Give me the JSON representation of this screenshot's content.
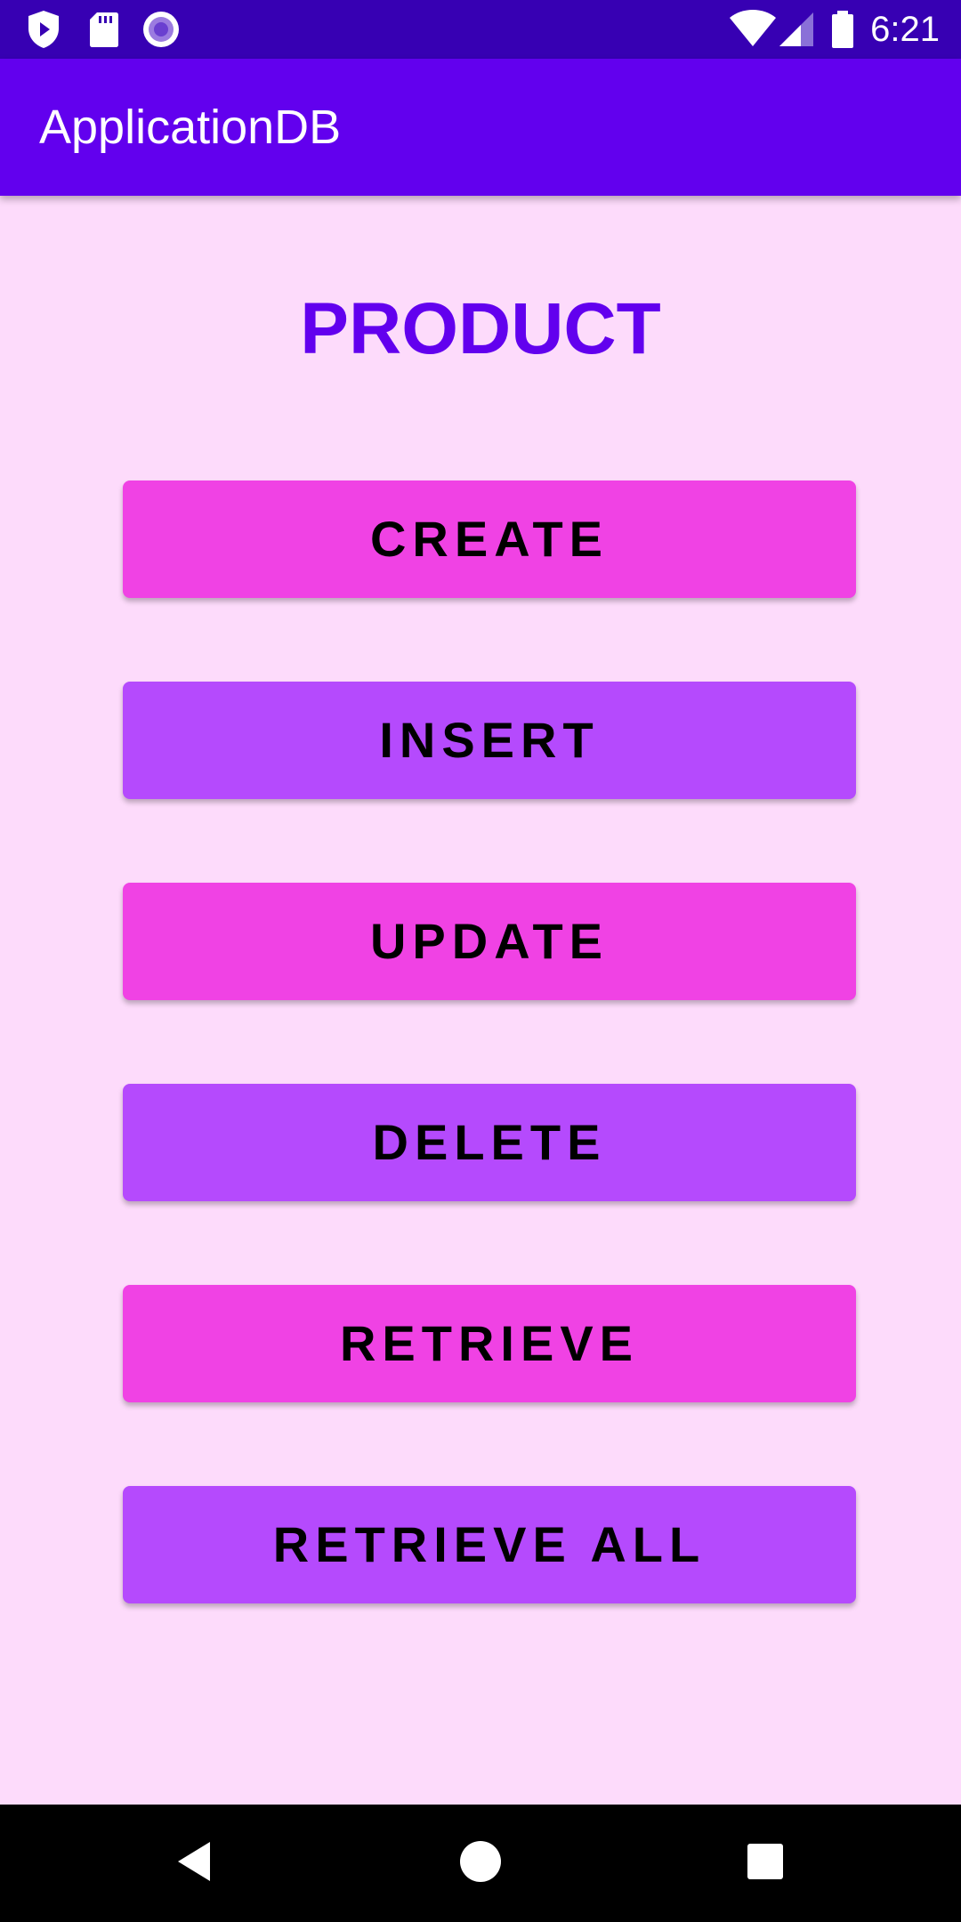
{
  "status_bar": {
    "time": "6:21",
    "left_icons": [
      "shield-play-icon",
      "sd-card-icon",
      "record-icon"
    ],
    "right_icons": [
      "wifi-icon",
      "cell-signal-icon",
      "battery-icon"
    ],
    "background": "#3700B3"
  },
  "app_bar": {
    "title": "ApplicationDB",
    "background": "#6200EE"
  },
  "main": {
    "heading": "PRODUCT",
    "heading_color": "#6200EE",
    "background": "#FDDBFB",
    "buttons": [
      {
        "label": "CREATE",
        "color": "#F042E4"
      },
      {
        "label": "INSERT",
        "color": "#B54AFD"
      },
      {
        "label": "UPDATE",
        "color": "#F042E4"
      },
      {
        "label": "DELETE",
        "color": "#B54AFD"
      },
      {
        "label": "RETRIEVE",
        "color": "#F042E4"
      },
      {
        "label": "RETRIEVE ALL",
        "color": "#B54AFD"
      }
    ]
  },
  "nav_bar": {
    "buttons": [
      "back-icon",
      "home-icon",
      "recents-icon"
    ],
    "background": "#000000"
  }
}
